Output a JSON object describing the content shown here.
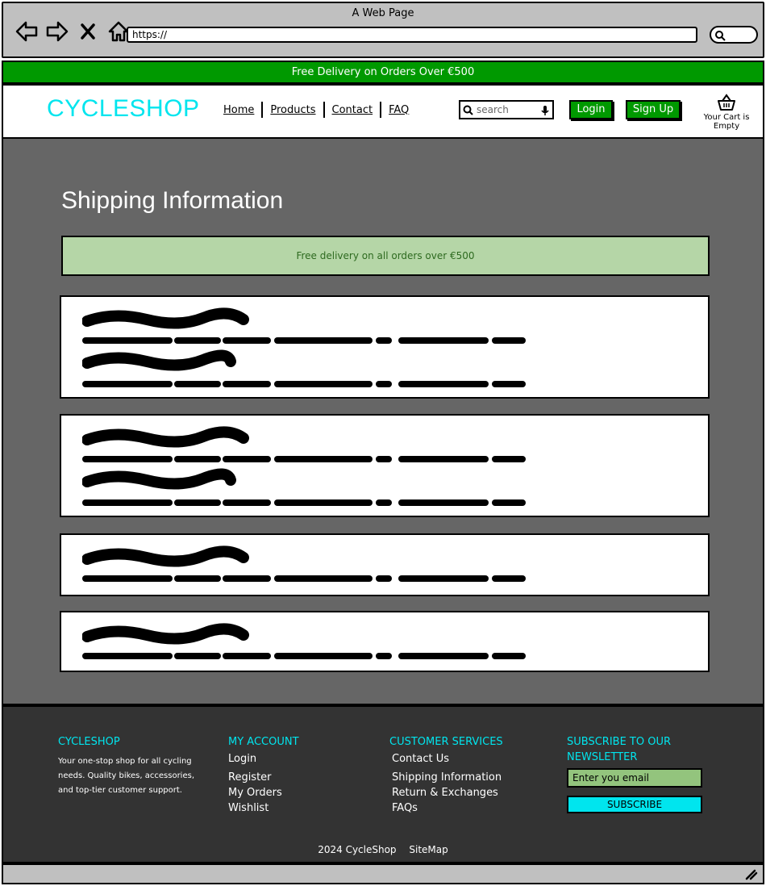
{
  "browser": {
    "window_title": "A Web Page",
    "url": "https://",
    "icons": [
      "back-arrow-icon",
      "forward-arrow-icon",
      "close-x-icon",
      "home-icon"
    ]
  },
  "promo": {
    "text": "Free Delivery on Orders Over €500"
  },
  "header": {
    "logo": "CYCLESHOP",
    "nav": [
      "Home",
      "Products",
      "Contact",
      "FAQ"
    ],
    "search_placeholder": "search",
    "login_label": "Login",
    "signup_label": "Sign Up",
    "cart_text": "Your Cart is Empty"
  },
  "main": {
    "title": "Shipping Information",
    "alert": "Free delivery on all orders over €500",
    "cards": [
      {
        "sections": 2
      },
      {
        "sections": 2
      },
      {
        "sections": 1
      },
      {
        "sections": 1
      }
    ]
  },
  "footer": {
    "brand": {
      "heading": "CYCLESHOP",
      "about": "Your one-stop shop for all cycling needs. Quality bikes, accessories, and top-tier customer support."
    },
    "account": {
      "heading": "MY ACCOUNT",
      "items": [
        "Login",
        "Register",
        "My Orders",
        "Wishlist"
      ]
    },
    "services": {
      "heading": "CUSTOMER SERVICES",
      "items": [
        "Contact Us",
        "Shipping Information",
        "Return & Exchanges",
        "FAQs"
      ]
    },
    "newsletter": {
      "heading": "SUBSCRIBE TO OUR NEWSLETTER",
      "input_value": "Enter you email",
      "button": "SUBSCRIBE"
    },
    "copyright": "2024 CycleShop",
    "sitemap": "SiteMap"
  },
  "colors": {
    "brand_cyan": "#00e5ee",
    "green": "#009900",
    "alert_bg": "#b5d6a7",
    "main_bg": "#666666",
    "footer_bg": "#333333"
  }
}
